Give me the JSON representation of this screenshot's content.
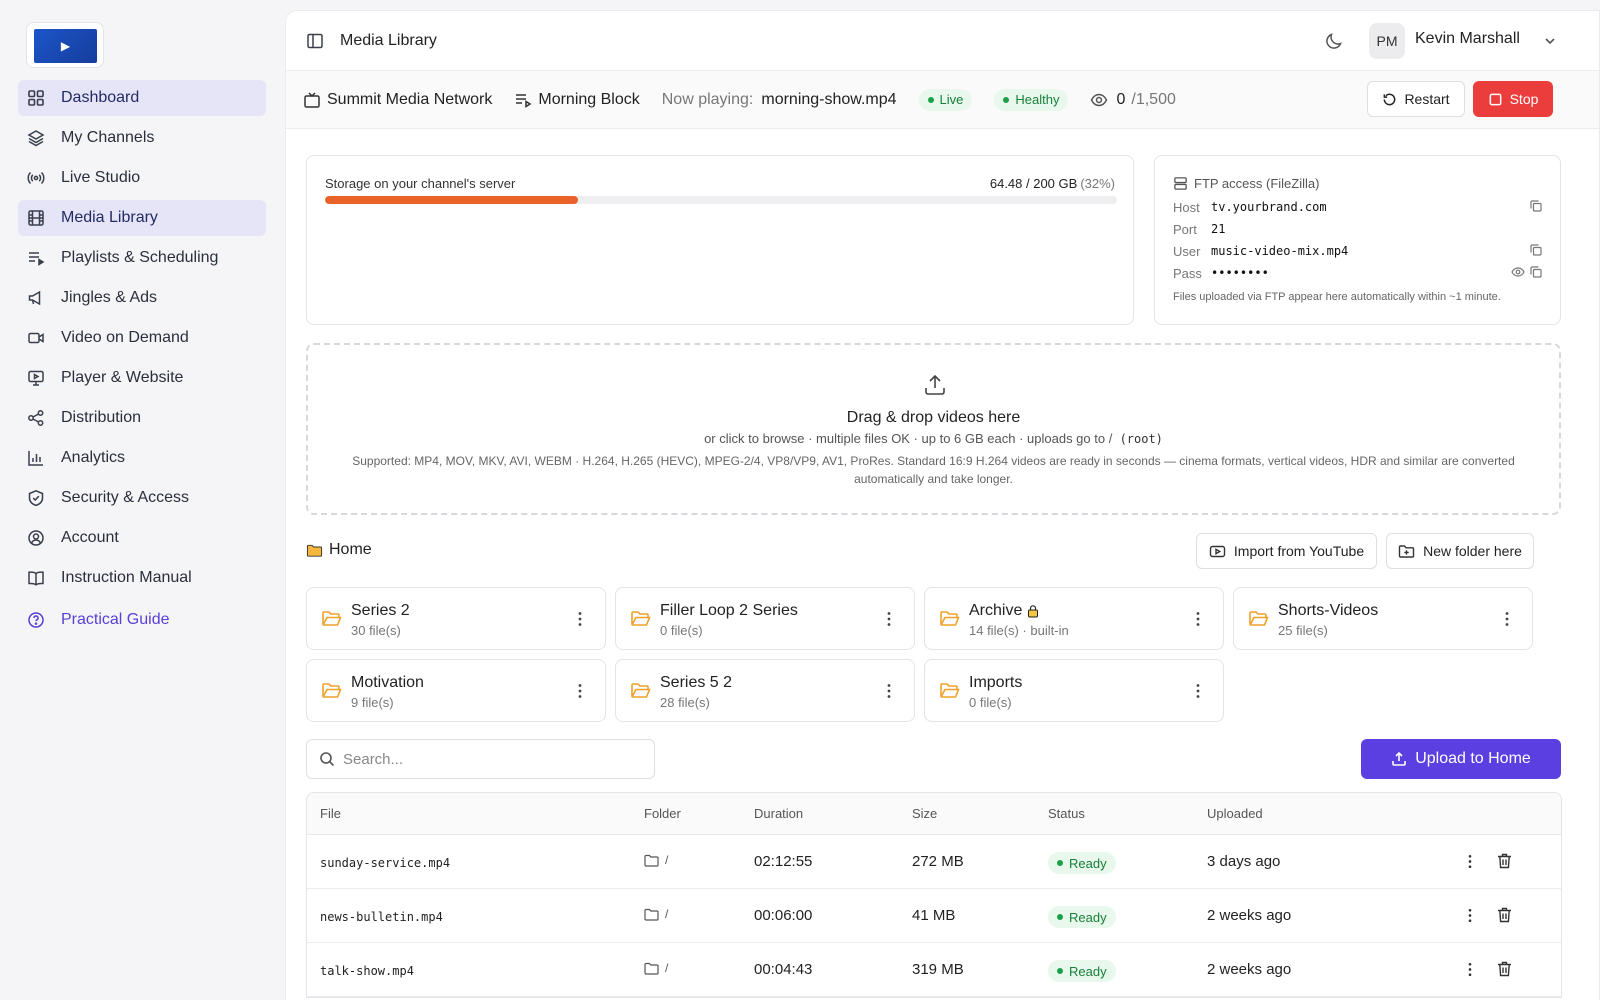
{
  "sidebar": {
    "logo_icon": "play-icon",
    "items": [
      {
        "label": "Dashboard",
        "icon": "grid-icon",
        "active": true
      },
      {
        "label": "My Channels",
        "icon": "layers-icon"
      },
      {
        "label": "Live Studio",
        "icon": "broadcast-icon"
      },
      {
        "label": "Media Library",
        "icon": "film-icon",
        "active": true
      },
      {
        "label": "Playlists & Scheduling",
        "icon": "playlist-icon"
      },
      {
        "label": "Jingles & Ads",
        "icon": "megaphone-icon"
      },
      {
        "label": "Video on Demand",
        "icon": "video-icon"
      },
      {
        "label": "Player & Website",
        "icon": "monitor-icon"
      },
      {
        "label": "Distribution",
        "icon": "share-icon"
      },
      {
        "label": "Analytics",
        "icon": "bar-chart-icon"
      },
      {
        "label": "Security & Access",
        "icon": "shield-icon"
      },
      {
        "label": "Account",
        "icon": "user-circle-icon"
      },
      {
        "label": "Instruction Manual",
        "icon": "book-icon"
      }
    ],
    "guide": {
      "label": "Practical Guide",
      "icon": "help-circle-icon"
    }
  },
  "header": {
    "title": "Media Library",
    "user_initials": "PM",
    "user_name": "Kevin Marshall"
  },
  "status_bar": {
    "channel": "Summit Media Network",
    "block": "Morning Block",
    "now_playing_label": "Now playing:",
    "now_playing": "morning-show.mp4",
    "live": "Live",
    "health": "Healthy",
    "viewers": "0",
    "viewers_max": "/1,500",
    "restart_label": "Restart",
    "stop_label": "Stop"
  },
  "storage": {
    "label": "Storage on your channel's server",
    "value": "64.48 / 200 GB",
    "percent_label": "(32%)",
    "percent": 32
  },
  "ftp": {
    "title": "FTP access (FileZilla)",
    "host_label": "Host",
    "host": "tv.yourbrand.com",
    "port_label": "Port",
    "port": "21",
    "user_label": "User",
    "user": "music-video-mix.mp4",
    "pass_label": "Pass",
    "pass": "••••••••",
    "note": "Files uploaded via FTP appear here automatically within ~1 minute."
  },
  "dropzone": {
    "title": "Drag & drop videos here",
    "sub": "or click to browse · multiple files OK · up to 6 GB each · uploads go to /",
    "root": "(root)",
    "supported": "Supported: MP4, MOV, MKV, AVI, WEBM · H.264, H.265 (HEVC), MPEG-2/4, VP8/VP9, AV1, ProRes. Standard 16:9 H.264 videos are ready in seconds — cinema formats, vertical videos, HDR and similar are converted automatically and take longer."
  },
  "folders_section": {
    "home_label": "Home",
    "import_label": "Import from YouTube",
    "new_folder_label": "New folder here",
    "folders": [
      {
        "name": "Series 2",
        "count": "30 file(s)"
      },
      {
        "name": "Filler Loop 2 Series",
        "count": "0 file(s)"
      },
      {
        "name": "Archive",
        "count": "14 file(s) · built-in",
        "locked": true
      },
      {
        "name": "Shorts-Videos",
        "count": "25 file(s)"
      },
      {
        "name": "Motivation",
        "count": "9 file(s)"
      },
      {
        "name": "Series 5 2",
        "count": "28 file(s)"
      },
      {
        "name": "Imports",
        "count": "0 file(s)"
      }
    ]
  },
  "search": {
    "placeholder": "Search..."
  },
  "upload_label": "Upload to Home",
  "table": {
    "headers": {
      "file": "File",
      "folder": "Folder",
      "duration": "Duration",
      "size": "Size",
      "status": "Status",
      "uploaded": "Uploaded"
    },
    "rows": [
      {
        "file": "sunday-service.mp4",
        "folder": "/",
        "duration": "02:12:55",
        "size": "272 MB",
        "status": "Ready",
        "uploaded": "3 days ago"
      },
      {
        "file": "news-bulletin.mp4",
        "folder": "/",
        "duration": "00:06:00",
        "size": "41 MB",
        "status": "Ready",
        "uploaded": "2 weeks ago"
      },
      {
        "file": "talk-show.mp4",
        "folder": "/",
        "duration": "00:04:43",
        "size": "319 MB",
        "status": "Ready",
        "uploaded": "2 weeks ago"
      }
    ]
  },
  "colors": {
    "accent": "#5b3fe0",
    "danger": "#ec3d3d",
    "storage": "#e8622a",
    "folder": "#f0a12b",
    "ok": "#1aa049"
  }
}
